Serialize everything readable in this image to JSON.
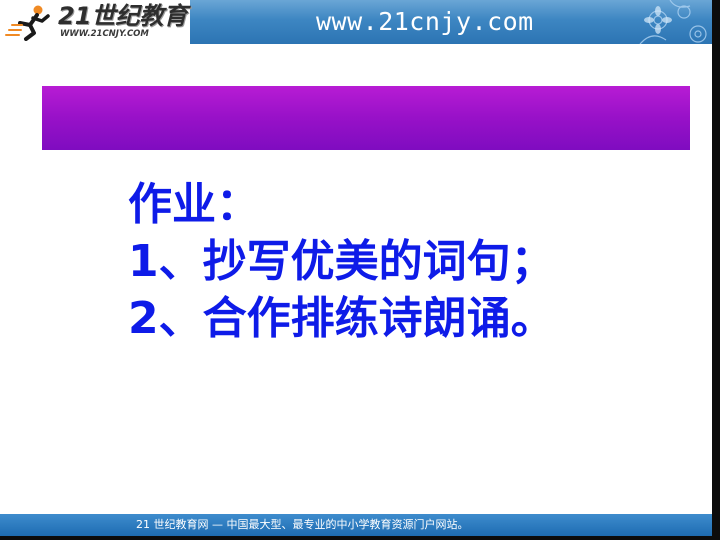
{
  "header": {
    "logo_main": "21世纪教育",
    "logo_sub": "WWW.21CNJY.COM",
    "url": "www.21cnjy.com",
    "logo_icon": "runner-icon"
  },
  "slide": {
    "title_bar_color": "#9811c8",
    "homework": {
      "heading": "作业：",
      "items": [
        "1、抄写优美的词句；",
        "2、合作排练诗朗诵。"
      ],
      "color": "#0e1be8"
    }
  },
  "footer": {
    "text": "21 世纪教育网 — 中国最大型、最专业的中小学教育资源门户网站。"
  },
  "colors": {
    "header_blue": "#3d86c2",
    "footer_blue": "#1e6cb2",
    "title_purple": "#9811c8",
    "text_blue": "#0e1be8"
  }
}
